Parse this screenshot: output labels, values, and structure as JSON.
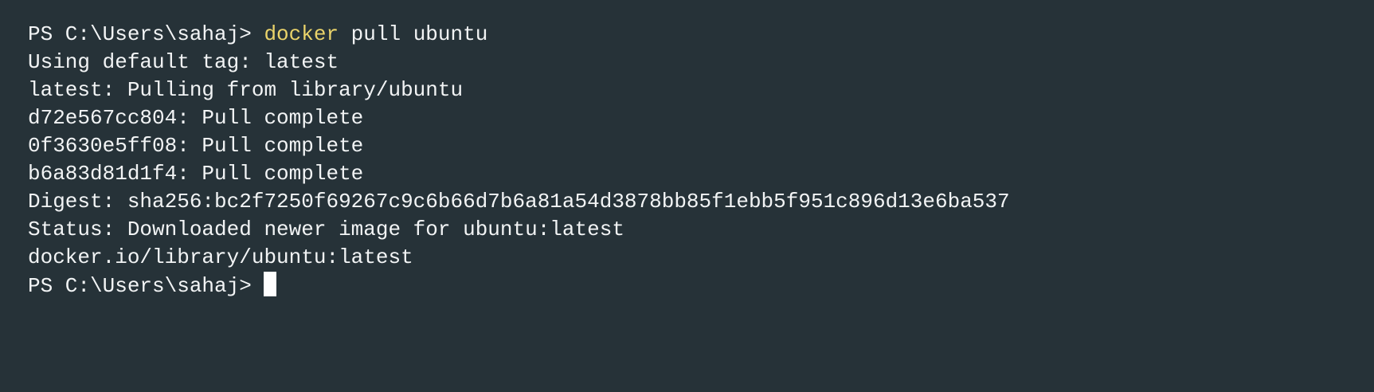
{
  "terminal": {
    "prompt": "PS C:\\Users\\sahaj> ",
    "command": {
      "keyword": "docker",
      "args": " pull ubuntu"
    },
    "output": [
      "Using default tag: latest",
      "latest: Pulling from library/ubuntu",
      "d72e567cc804: Pull complete",
      "0f3630e5ff08: Pull complete",
      "b6a83d81d1f4: Pull complete",
      "Digest: sha256:bc2f7250f69267c9c6b66d7b6a81a54d3878bb85f1ebb5f951c896d13e6ba537",
      "Status: Downloaded newer image for ubuntu:latest",
      "docker.io/library/ubuntu:latest"
    ],
    "final_prompt": "PS C:\\Users\\sahaj> "
  },
  "colors": {
    "background": "#263238",
    "text": "#f2f4f5",
    "command_keyword": "#ead36a",
    "cursor": "#ffffff"
  }
}
